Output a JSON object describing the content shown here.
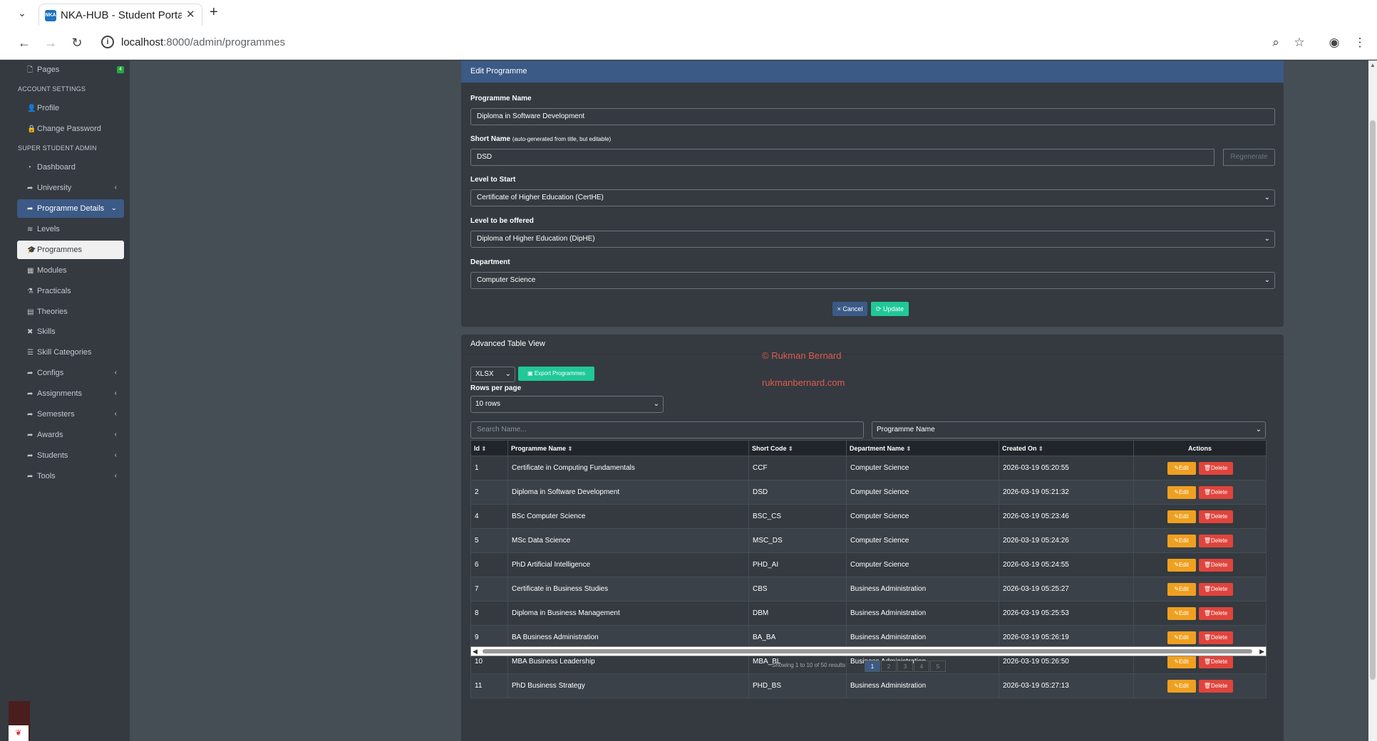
{
  "browser": {
    "tab_title": "NKA-HUB - Student Portal",
    "favicon_text": "NKA",
    "url_host": "localhost",
    "url_path": ":8000/admin/programmes",
    "new_tab": "+",
    "close": "✕",
    "tab_list": "⌄"
  },
  "sidebar": {
    "pages": {
      "label": "Pages",
      "badge": "4"
    },
    "account_heading": "ACCOUNT SETTINGS",
    "profile": "Profile",
    "change_password": "Change Password",
    "admin_heading": "SUPER STUDENT ADMIN",
    "items": [
      {
        "label": "Dashboard",
        "icon": "dashboard-icon"
      },
      {
        "label": "University",
        "icon": "share-icon"
      },
      {
        "label": "Programme Details",
        "icon": "share-icon"
      },
      {
        "label": "Levels",
        "icon": "layers-icon"
      },
      {
        "label": "Programmes",
        "icon": "graduation-cap-icon"
      },
      {
        "label": "Modules",
        "icon": "cubes-icon"
      },
      {
        "label": "Practicals",
        "icon": "flask-icon"
      },
      {
        "label": "Theories",
        "icon": "book-icon"
      },
      {
        "label": "Skills",
        "icon": "tools-icon"
      },
      {
        "label": "Skill Categories",
        "icon": "list-icon"
      },
      {
        "label": "Configs",
        "icon": "share-icon"
      },
      {
        "label": "Assignments",
        "icon": "share-icon"
      },
      {
        "label": "Semesters",
        "icon": "share-icon"
      },
      {
        "label": "Awards",
        "icon": "share-icon"
      },
      {
        "label": "Students",
        "icon": "share-icon"
      },
      {
        "label": "Tools",
        "icon": "share-icon"
      }
    ]
  },
  "edit_form": {
    "title": "Edit Programme",
    "programme_name_label": "Programme Name",
    "programme_name_value": "Diploma in Software Development",
    "short_name_label": "Short Name",
    "short_name_hint": "(auto-generated from title, but editable)",
    "short_name_value": "DSD",
    "regenerate": "Regenerate",
    "level_start_label": "Level to Start",
    "level_start_value": "Certificate of Higher Education (CertHE)",
    "level_offered_label": "Level to be offered",
    "level_offered_value": "Diploma of Higher Education (DipHE)",
    "department_label": "Department",
    "department_value": "Computer Science",
    "cancel": "× Cancel",
    "update": "⟳ Update"
  },
  "table_view": {
    "title": "Advanced Table View",
    "watermark1": "© Rukman Bernard",
    "watermark2": "rukmanbernard.com",
    "format_value": "XLSX",
    "export_label": "Export Programmes",
    "rows_per_page_label": "Rows per page",
    "rows_per_page_value": "10 rows",
    "search_placeholder": "Search Name...",
    "filter_column_value": "Programme Name",
    "columns": [
      "Id",
      "Programme Name",
      "Short Code",
      "Department Name",
      "Created On",
      "Actions"
    ],
    "rows": [
      [
        "1",
        "Certificate in Computing Fundamentals",
        "CCF",
        "Computer Science",
        "2026-03-19 05:20:55"
      ],
      [
        "2",
        "Diploma in Software Development",
        "DSD",
        "Computer Science",
        "2026-03-19 05:21:32"
      ],
      [
        "4",
        "BSc Computer Science",
        "BSC_CS",
        "Computer Science",
        "2026-03-19 05:23:46"
      ],
      [
        "5",
        "MSc Data Science",
        "MSC_DS",
        "Computer Science",
        "2026-03-19 05:24:26"
      ],
      [
        "6",
        "PhD Artificial Intelligence",
        "PHD_AI",
        "Computer Science",
        "2026-03-19 05:24:55"
      ],
      [
        "7",
        "Certificate in Business Studies",
        "CBS",
        "Business Administration",
        "2026-03-19 05:25:27"
      ],
      [
        "8",
        "Diploma in Business Management",
        "DBM",
        "Business Administration",
        "2026-03-19 05:25:53"
      ],
      [
        "9",
        "BA Business Administration",
        "BA_BA",
        "Business Administration",
        "2026-03-19 05:26:19"
      ],
      [
        "10",
        "MBA Business Leadership",
        "MBA_BL",
        "Business Administration",
        "2026-03-19 05:26:50"
      ],
      [
        "11",
        "PhD Business Strategy",
        "PHD_BS",
        "Business Administration",
        "2026-03-19 05:27:13"
      ]
    ],
    "edit_label": "Edit",
    "delete_label": "Delete",
    "pagination_text": "Showing 1 to 10 of 50 results",
    "pages": [
      "1",
      "2",
      "3",
      "4",
      "5"
    ]
  },
  "colors": {
    "primary": "#3c5a86",
    "success": "#20c997",
    "warning": "#f0a020",
    "danger": "#e0443c",
    "dark": "#343a40"
  }
}
